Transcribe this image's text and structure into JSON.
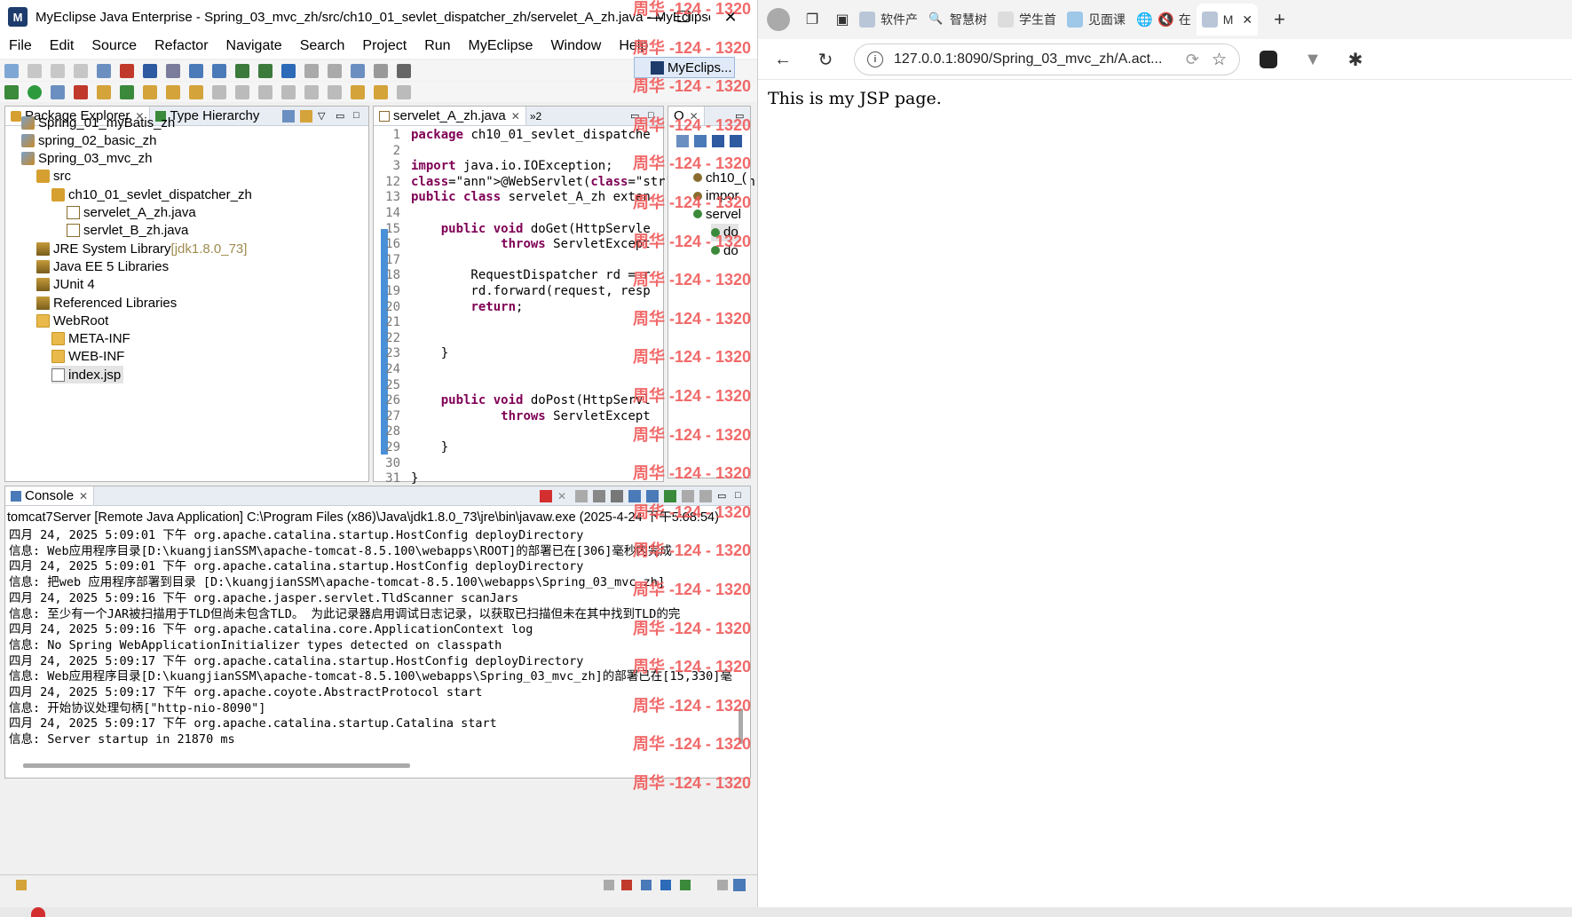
{
  "ide": {
    "window_title": "MyEclipse Java Enterprise - Spring_03_mvc_zh/src/ch10_01_sevlet_dispatcher_zh/servelet_A_zh.java - MyEclipse...",
    "menu": [
      "File",
      "Edit",
      "Source",
      "Refactor",
      "Navigate",
      "Search",
      "Project",
      "Run",
      "MyEclipse",
      "Window",
      "Help"
    ],
    "perspective_label": "MyEclips...",
    "package_explorer": {
      "tabs": [
        "Package Explorer",
        "Type Hierarchy"
      ],
      "items": [
        {
          "label": "Spring_01_myBatis_zh",
          "level": 0,
          "icon": "project-icon"
        },
        {
          "label": "spring_02_basic_zh",
          "level": 0,
          "icon": "project-icon"
        },
        {
          "label": "Spring_03_mvc_zh",
          "level": 0,
          "icon": "project-icon"
        },
        {
          "label": "src",
          "level": 1,
          "icon": "source-folder-icon"
        },
        {
          "label": "ch10_01_sevlet_dispatcher_zh",
          "level": 2,
          "icon": "package-icon"
        },
        {
          "label": "servelet_A_zh.java",
          "level": 3,
          "icon": "java-file-icon"
        },
        {
          "label": "servlet_B_zh.java",
          "level": 3,
          "icon": "java-file-icon"
        },
        {
          "label": "JRE System Library",
          "suffix": "[jdk1.8.0_73]",
          "level": 1,
          "icon": "library-icon"
        },
        {
          "label": "Java EE 5 Libraries",
          "level": 1,
          "icon": "library-icon"
        },
        {
          "label": "JUnit 4",
          "level": 1,
          "icon": "library-icon"
        },
        {
          "label": "Referenced Libraries",
          "level": 1,
          "icon": "library-icon"
        },
        {
          "label": "WebRoot",
          "level": 1,
          "icon": "folder-icon"
        },
        {
          "label": "META-INF",
          "level": 2,
          "icon": "folder-icon"
        },
        {
          "label": "WEB-INF",
          "level": 2,
          "icon": "folder-icon"
        },
        {
          "label": "index.jsp",
          "level": 2,
          "icon": "jsp-file-icon",
          "selected": true
        }
      ]
    },
    "editor": {
      "tab": "servelet_A_zh.java",
      "overflow": "»2",
      "line_numbers": [
        "1",
        "2",
        "3",
        "12",
        "13",
        "14",
        "15",
        "16",
        "17",
        "18",
        "19",
        "20",
        "21",
        "22",
        "23",
        "24",
        "25",
        "26",
        "27",
        "28",
        "29",
        "30",
        "31"
      ],
      "lines": [
        "package ch10_01_sevlet_dispatche",
        "",
        "import java.io.IOException;",
        "@WebServlet(\"/A.action\")",
        "public class servelet_A_zh exten",
        "",
        "    public void doGet(HttpServle",
        "            throws ServletExcept",
        "",
        "        RequestDispatcher rd = r",
        "        rd.forward(request, resp",
        "        return;",
        "",
        "",
        "    }",
        "",
        "",
        "    public void doPost(HttpServl",
        "            throws ServletExcept",
        "",
        "    }",
        "",
        "}"
      ]
    },
    "outline": {
      "tab": "O",
      "items": [
        "ch10_(",
        "impor",
        "servel",
        "do",
        "do"
      ]
    },
    "console": {
      "tab": "Console",
      "header": "tomcat7Server [Remote Java Application] C:\\Program Files (x86)\\Java\\jdk1.8.0_73\\jre\\bin\\javaw.exe (2025-4-24 下午5:08:54)",
      "lines": [
        "四月 24, 2025 5:09:01 下午 org.apache.catalina.startup.HostConfig deployDirectory",
        "信息: Web应用程序目录[D:\\kuangjianSSM\\apache-tomcat-8.5.100\\webapps\\ROOT]的部署已在[306]毫秒内完成",
        "四月 24, 2025 5:09:01 下午 org.apache.catalina.startup.HostConfig deployDirectory",
        "信息: 把web 应用程序部署到目录 [D:\\kuangjianSSM\\apache-tomcat-8.5.100\\webapps\\Spring_03_mvc_zh]",
        "四月 24, 2025 5:09:16 下午 org.apache.jasper.servlet.TldScanner scanJars",
        "信息: 至少有一个JAR被扫描用于TLD但尚未包含TLD。 为此记录器启用调试日志记录，以获取已扫描但未在其中找到TLD的完",
        "四月 24, 2025 5:09:16 下午 org.apache.catalina.core.ApplicationContext log",
        "信息: No Spring WebApplicationInitializer types detected on classpath",
        "四月 24, 2025 5:09:17 下午 org.apache.catalina.startup.HostConfig deployDirectory",
        "信息: Web应用程序目录[D:\\kuangjianSSM\\apache-tomcat-8.5.100\\webapps\\Spring_03_mvc_zh]的部署已在[15,330]毫",
        "四月 24, 2025 5:09:17 下午 org.apache.coyote.AbstractProtocol start",
        "信息: 开始协议处理句柄[\"http-nio-8090\"]",
        "四月 24, 2025 5:09:17 下午 org.apache.catalina.startup.Catalina start",
        "信息: Server startup in 21870 ms"
      ]
    },
    "watermark": "周华 -124 - 1320"
  },
  "browser": {
    "tabs": [
      "软件产",
      "智慧树",
      "学生首",
      "见面课",
      "在",
      "M"
    ],
    "url": "127.0.0.1:8090/Spring_03_mvc_zh/A.act...",
    "page_text": "This is my JSP page."
  },
  "colors": {
    "keyword": "#7f0055",
    "string": "#2a00ff",
    "watermark": "#f05a5a"
  }
}
